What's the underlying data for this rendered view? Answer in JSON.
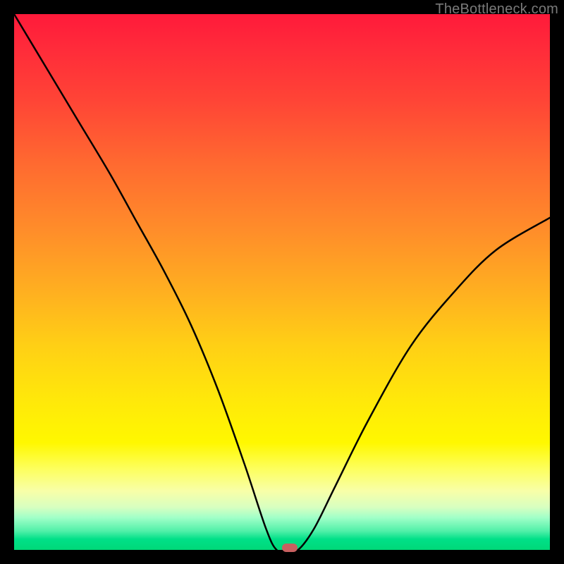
{
  "watermark": "TheBottleneck.com",
  "chart_data": {
    "type": "line",
    "title": "",
    "xlabel": "",
    "ylabel": "",
    "xlim": [
      0,
      100
    ],
    "ylim": [
      0,
      100
    ],
    "grid": false,
    "legend": false,
    "series": [
      {
        "name": "bottleneck-curve",
        "x": [
          0,
          6,
          12,
          18,
          23,
          28,
          33,
          38,
          43,
          47,
          49,
          51,
          53,
          56,
          60,
          66,
          74,
          82,
          90,
          100
        ],
        "y": [
          100,
          90,
          80,
          70,
          61,
          52,
          42,
          30,
          16,
          4,
          0,
          0,
          0,
          4,
          12,
          24,
          38,
          48,
          56,
          62
        ]
      }
    ],
    "marker": {
      "x": 51.5,
      "y": 0,
      "shape": "pill",
      "color": "#c86060"
    },
    "background_gradient": {
      "direction": "vertical",
      "stops": [
        {
          "pos": 0.0,
          "color": "#ff1a3a"
        },
        {
          "pos": 0.5,
          "color": "#ffb020"
        },
        {
          "pos": 0.8,
          "color": "#fff800"
        },
        {
          "pos": 1.0,
          "color": "#00d878"
        }
      ]
    }
  }
}
